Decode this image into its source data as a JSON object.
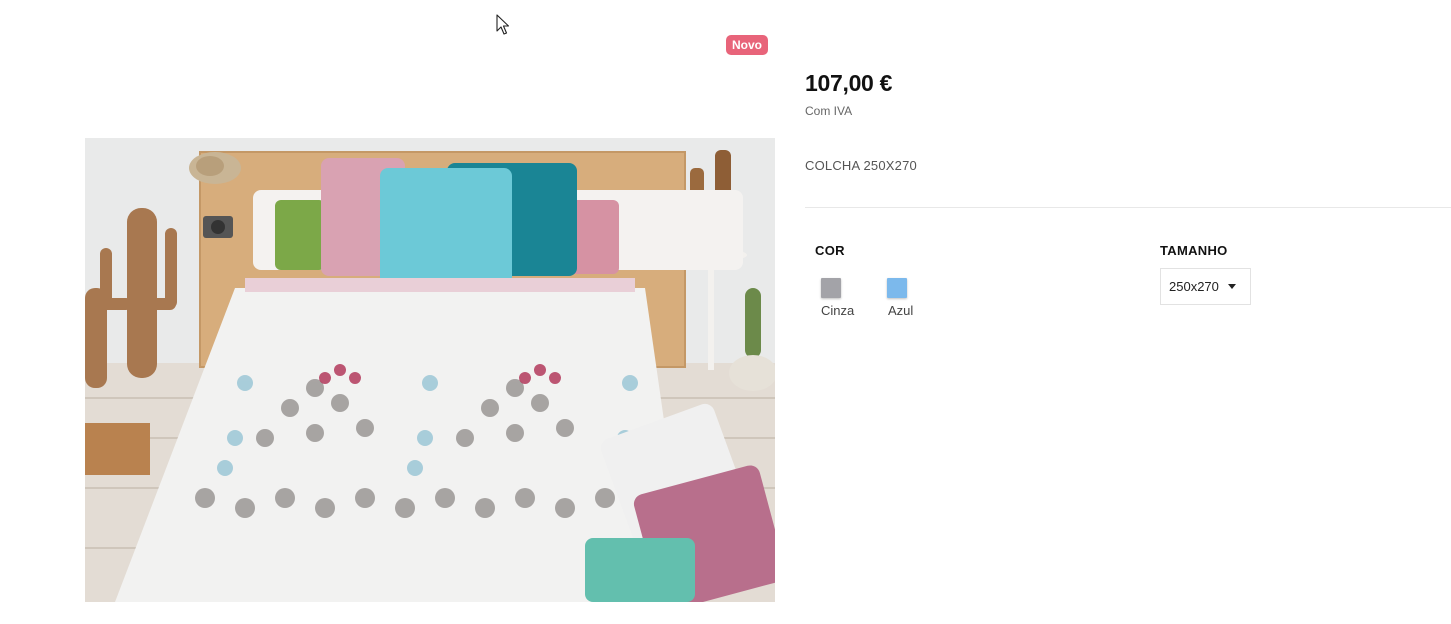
{
  "badge": {
    "label": "Novo",
    "color": "#e8647a"
  },
  "product": {
    "price": "107,00 €",
    "tax_note": "Com IVA",
    "name": "COLCHA 250X270"
  },
  "options": {
    "color": {
      "heading": "COR",
      "items": [
        {
          "label": "Cinza",
          "swatch": "#a3a3a8"
        },
        {
          "label": "Azul",
          "swatch": "#7cb9ec"
        }
      ]
    },
    "size": {
      "heading": "TAMANHO",
      "selected": "250x270"
    }
  }
}
